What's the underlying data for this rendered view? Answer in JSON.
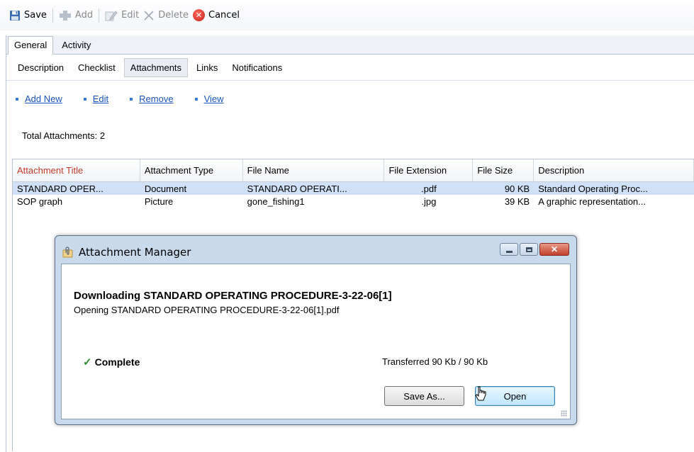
{
  "toolbar": {
    "save": "Save",
    "add": "Add",
    "edit": "Edit",
    "delete": "Delete",
    "cancel": "Cancel"
  },
  "tabs_primary": [
    {
      "label": "General",
      "active": true
    },
    {
      "label": "Activity",
      "active": false
    }
  ],
  "tabs_secondary": [
    {
      "label": "Description",
      "active": false
    },
    {
      "label": "Checklist",
      "active": false
    },
    {
      "label": "Attachments",
      "active": true
    },
    {
      "label": "Links",
      "active": false
    },
    {
      "label": "Notifications",
      "active": false
    }
  ],
  "actions": {
    "add_new": "Add New",
    "edit": "Edit",
    "remove": "Remove",
    "view": "View"
  },
  "total_text": "Total Attachments: 2",
  "grid": {
    "headers": [
      "Attachment Title",
      "Attachment Type",
      "File Name",
      "File Extension",
      "File Size",
      "Description"
    ],
    "rows": [
      [
        "STANDARD OPER...",
        "Document",
        "STANDARD OPERATI...",
        ".pdf",
        "90 KB",
        "Standard Operating Proc..."
      ],
      [
        "SOP graph",
        "Picture",
        "gone_fishing1",
        ".jpg",
        "39 KB",
        "A graphic representation..."
      ]
    ]
  },
  "dialog": {
    "title": "Attachment Manager",
    "close_glyph": "✕",
    "downloading": "Downloading STANDARD OPERATING PROCEDURE-3-22-06[1]",
    "opening": "Opening STANDARD OPERATING PROCEDURE-3-22-06[1].pdf",
    "status": "Complete",
    "check_glyph": "✓",
    "transferred": "Transferred 90 Kb / 90 Kb",
    "save_as": "Save As...",
    "open": "Open"
  },
  "colors": {
    "link": "#1a52b8",
    "selected_row": "#cfe0f7",
    "sorted_header": "#c0392b",
    "complete_check": "#2d8a2d"
  }
}
